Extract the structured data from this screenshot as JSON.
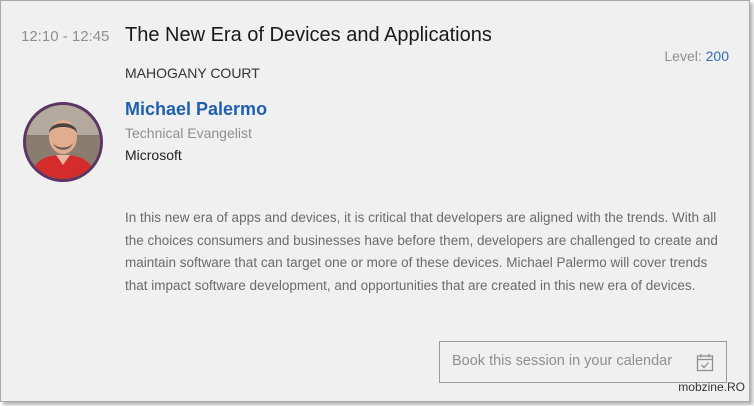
{
  "session": {
    "time": "12:10 - 12:45",
    "title": "The New Era of Devices and Applications",
    "level_label": "Level:",
    "level_value": "200",
    "room": "MAHOGANY COURT"
  },
  "speaker": {
    "name": "Michael Palermo",
    "role": "Technical Evangelist",
    "company": "Microsoft"
  },
  "description": "In this new era of apps and devices, it is critical that developers are aligned with the trends. With all the choices consumers and businesses have before them, developers are challenged to create and maintain software that can target one or more of these devices. Michael Palermo will cover trends that impact software development, and opportunities that are created in this new era of devices.",
  "actions": {
    "book_label": "Book this session in your calendar",
    "book_icon": "calendar-check-icon"
  },
  "watermark": "mobzine.RO",
  "colors": {
    "accent": "#1f5fb0",
    "level_value": "#2f6db5",
    "avatar_border": "#5c3566"
  }
}
